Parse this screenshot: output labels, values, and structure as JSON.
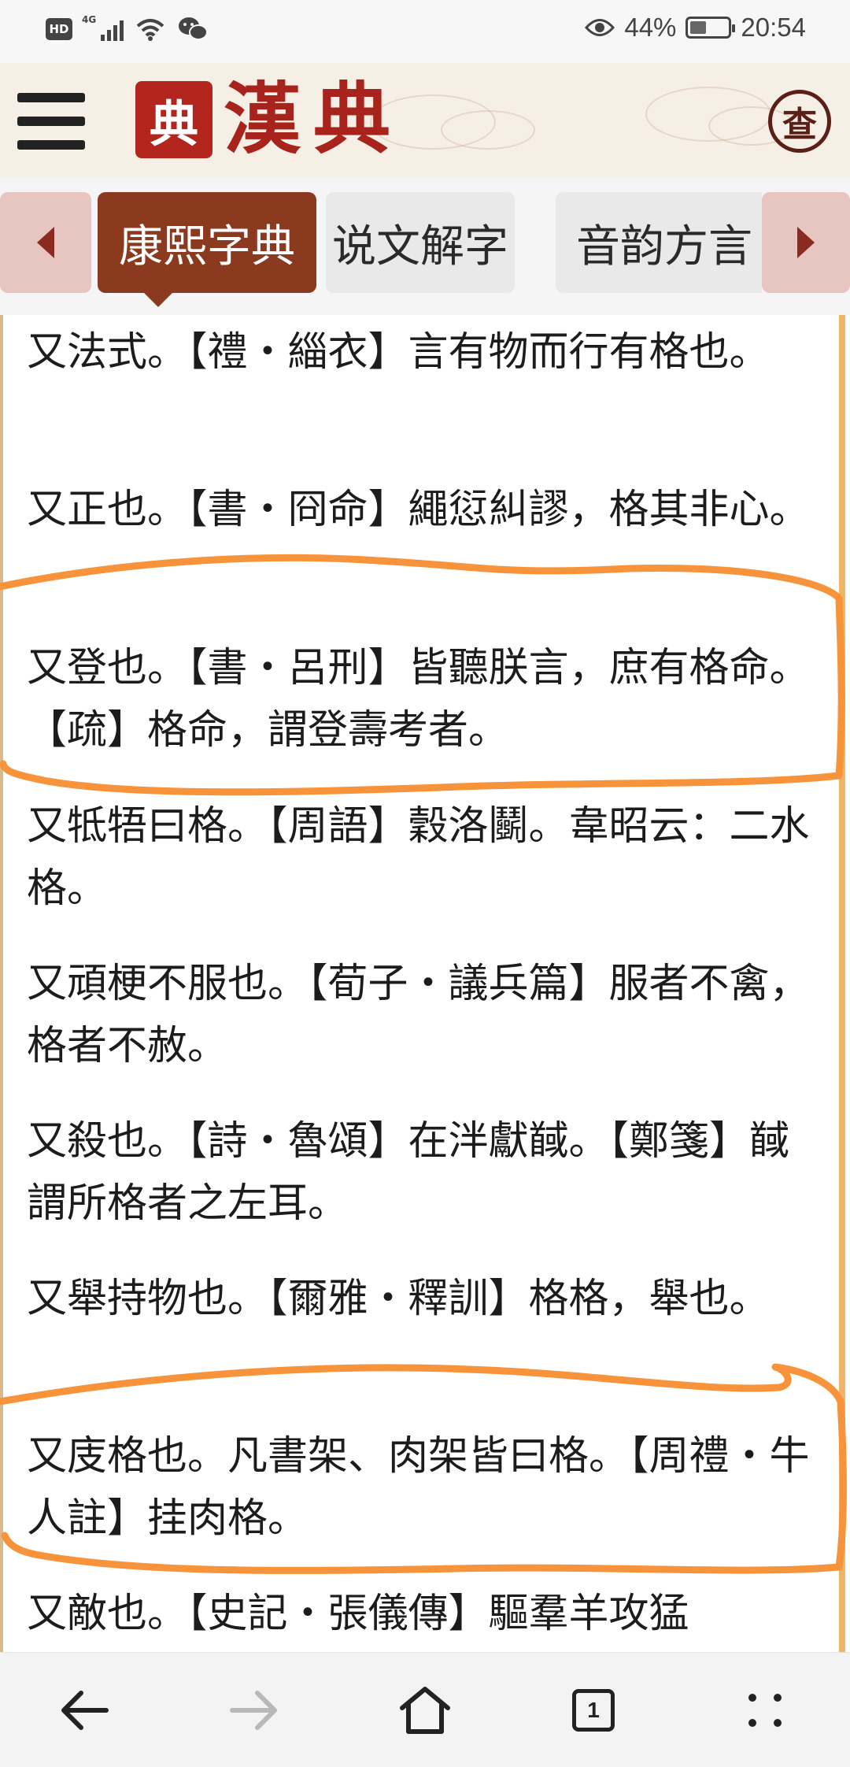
{
  "status_bar": {
    "hd_label": "HD",
    "network_label": "4G",
    "battery_percent": "44%",
    "battery_level": 0.44,
    "time": "20:54",
    "icons": [
      "hd-icon",
      "signal-icon",
      "wifi-icon",
      "wechat-icon",
      "eye-icon",
      "battery-icon"
    ]
  },
  "header": {
    "seal_char": "典",
    "title": "漢典",
    "search_char": "查",
    "icons": [
      "menu-icon",
      "logo-seal-icon",
      "search-icon"
    ]
  },
  "tabs": {
    "items": [
      {
        "label": "康熙字典",
        "active": true
      },
      {
        "label": "说文解字",
        "active": false
      },
      {
        "label": "音韵方言",
        "active": false
      }
    ],
    "icons": [
      "chevron-left-icon",
      "chevron-right-icon"
    ]
  },
  "content": {
    "paragraphs": [
      {
        "text": "又法式。【禮・緇衣】言有物而行有格也。"
      },
      {
        "text": "又正也。【書・冏命】繩愆糾謬，格其非心。"
      },
      {
        "text": "又登也。【書・呂刑】皆聽朕言，庶有格命。【疏】格命，謂登壽考者。"
      },
      {
        "text": "又牴牾曰格。【周語】穀洛鬬。韋昭云：二水格。"
      },
      {
        "text": "又頑梗不服也。【荀子・議兵篇】服者不禽，格者不赦。"
      },
      {
        "text": "又殺也。【詩・魯頌】在泮獻馘。【鄭箋】馘謂所格者之左耳。"
      },
      {
        "text": "又舉持物也。【爾雅・釋訓】格格，舉也。"
      },
      {
        "text": "又庋格也。凡書架、肉架皆曰格。【周禮・牛人註】挂肉格。"
      },
      {
        "text": "又敵也。【史記・張儀傳】驅羣羊攻猛"
      }
    ],
    "annotation_color": "#f7933a"
  },
  "bottom_nav": {
    "tab_count": "1",
    "icons": [
      "back-arrow-icon",
      "forward-arrow-icon",
      "home-icon",
      "tabs-icon",
      "more-icon"
    ]
  }
}
